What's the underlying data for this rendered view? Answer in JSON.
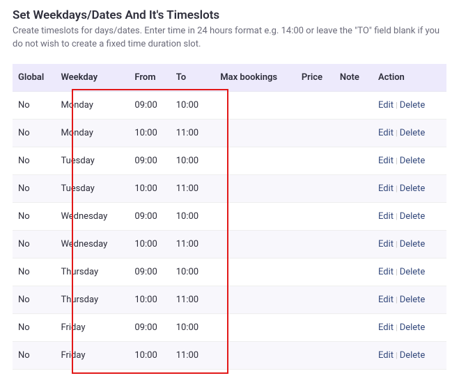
{
  "header": {
    "title": "Set Weekdays/Dates And It's Timeslots",
    "subtitle": "Create timeslots for days/dates. Enter time in 24 hours format e.g. 14:00 or leave the \"TO\" field blank if you do not wish to create a fixed time duration slot."
  },
  "table": {
    "columns": {
      "global": "Global",
      "weekday": "Weekday",
      "from": "From",
      "to": "To",
      "max": "Max bookings",
      "price": "Price",
      "note": "Note",
      "action": "Action"
    },
    "actions": {
      "edit": "Edit",
      "delete": "Delete"
    },
    "rows": [
      {
        "global": "No",
        "weekday": "Monday",
        "from": "09:00",
        "to": "10:00",
        "max": "",
        "price": "",
        "note": ""
      },
      {
        "global": "No",
        "weekday": "Monday",
        "from": "10:00",
        "to": "11:00",
        "max": "",
        "price": "",
        "note": ""
      },
      {
        "global": "No",
        "weekday": "Tuesday",
        "from": "09:00",
        "to": "10:00",
        "max": "",
        "price": "",
        "note": ""
      },
      {
        "global": "No",
        "weekday": "Tuesday",
        "from": "10:00",
        "to": "11:00",
        "max": "",
        "price": "",
        "note": ""
      },
      {
        "global": "No",
        "weekday": "Wednesday",
        "from": "09:00",
        "to": "10:00",
        "max": "",
        "price": "",
        "note": ""
      },
      {
        "global": "No",
        "weekday": "Wednesday",
        "from": "10:00",
        "to": "11:00",
        "max": "",
        "price": "",
        "note": ""
      },
      {
        "global": "No",
        "weekday": "Thursday",
        "from": "09:00",
        "to": "10:00",
        "max": "",
        "price": "",
        "note": ""
      },
      {
        "global": "No",
        "weekday": "Thursday",
        "from": "10:00",
        "to": "11:00",
        "max": "",
        "price": "",
        "note": ""
      },
      {
        "global": "No",
        "weekday": "Friday",
        "from": "09:00",
        "to": "10:00",
        "max": "",
        "price": "",
        "note": ""
      },
      {
        "global": "No",
        "weekday": "Friday",
        "from": "10:00",
        "to": "11:00",
        "max": "",
        "price": "",
        "note": ""
      }
    ]
  }
}
